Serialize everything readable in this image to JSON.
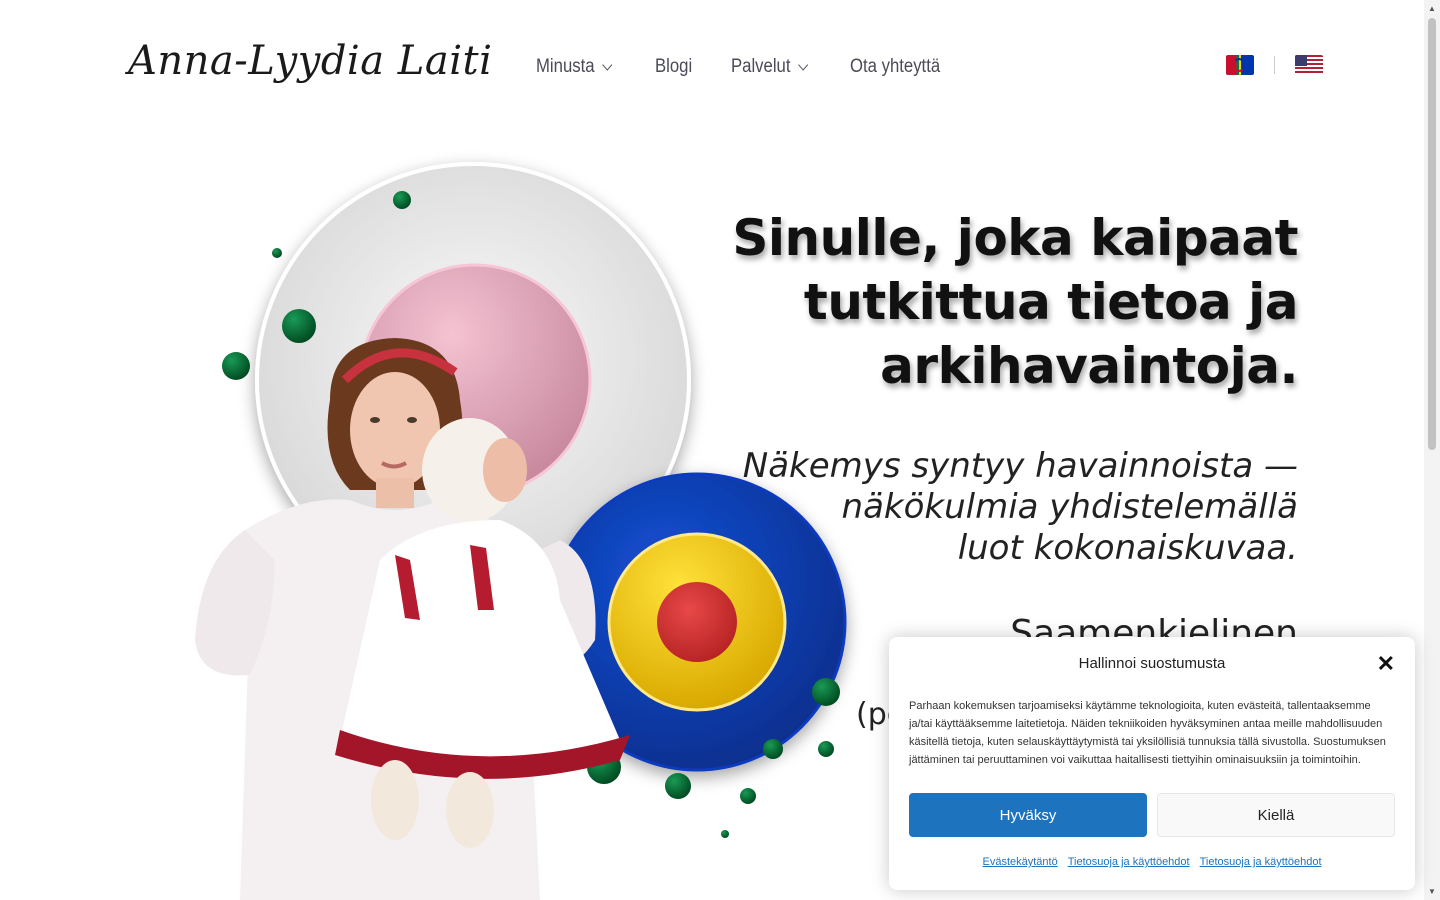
{
  "header": {
    "logo_text": "Anna-Lyydia Laiti",
    "nav": [
      {
        "label": "Minusta",
        "has_dropdown": true
      },
      {
        "label": "Blogi",
        "has_dropdown": false
      },
      {
        "label": "Palvelut",
        "has_dropdown": true
      },
      {
        "label": "Ota yhteyttä",
        "has_dropdown": false
      }
    ],
    "languages": [
      {
        "icon": "sami-flag-icon"
      },
      {
        "icon": "us-flag-icon"
      }
    ]
  },
  "hero": {
    "headline_lines": [
      "Sinulle, joka kaipaat",
      "tutkittua tietoa ja",
      "arkihavaintoja."
    ],
    "tagline_lines": [
      "Näkemys syntyy havainnoista  —",
      "näkökulmia yhdistelemällä",
      "luot kokonaiskuvaa."
    ],
    "sub_line": "Saamenkielinen",
    "sub_line2": "(po"
  },
  "colors": {
    "accent": "#1e73be",
    "green_dot": "#006b35",
    "blue_circle": "#0a3fb0",
    "yellow_circle": "#f2c500",
    "red_circle": "#d93333",
    "pink_circle": "#e4a9bb"
  },
  "consent": {
    "title": "Hallinnoi suostumusta",
    "body": "Parhaan kokemuksen tarjoamiseksi käytämme teknologioita, kuten evästeitä, tallentaaksemme ja/tai käyttääksemme laitetietoja. Näiden tekniikoiden hyväksyminen antaa meille mahdollisuuden käsitellä tietoja, kuten selauskäyttäytymistä tai yksilöllisiä tunnuksia tällä sivustolla. Suostumuksen jättäminen tai peruuttaminen voi vaikuttaa haitallisesti tiettyihin ominaisuuksiin ja toimintoihin.",
    "accept_label": "Hyväksy",
    "deny_label": "Kiellä",
    "links": [
      "Evästekäytäntö",
      "Tietosuoja ja käyttöehdot",
      "Tietosuoja ja käyttöehdot"
    ]
  }
}
